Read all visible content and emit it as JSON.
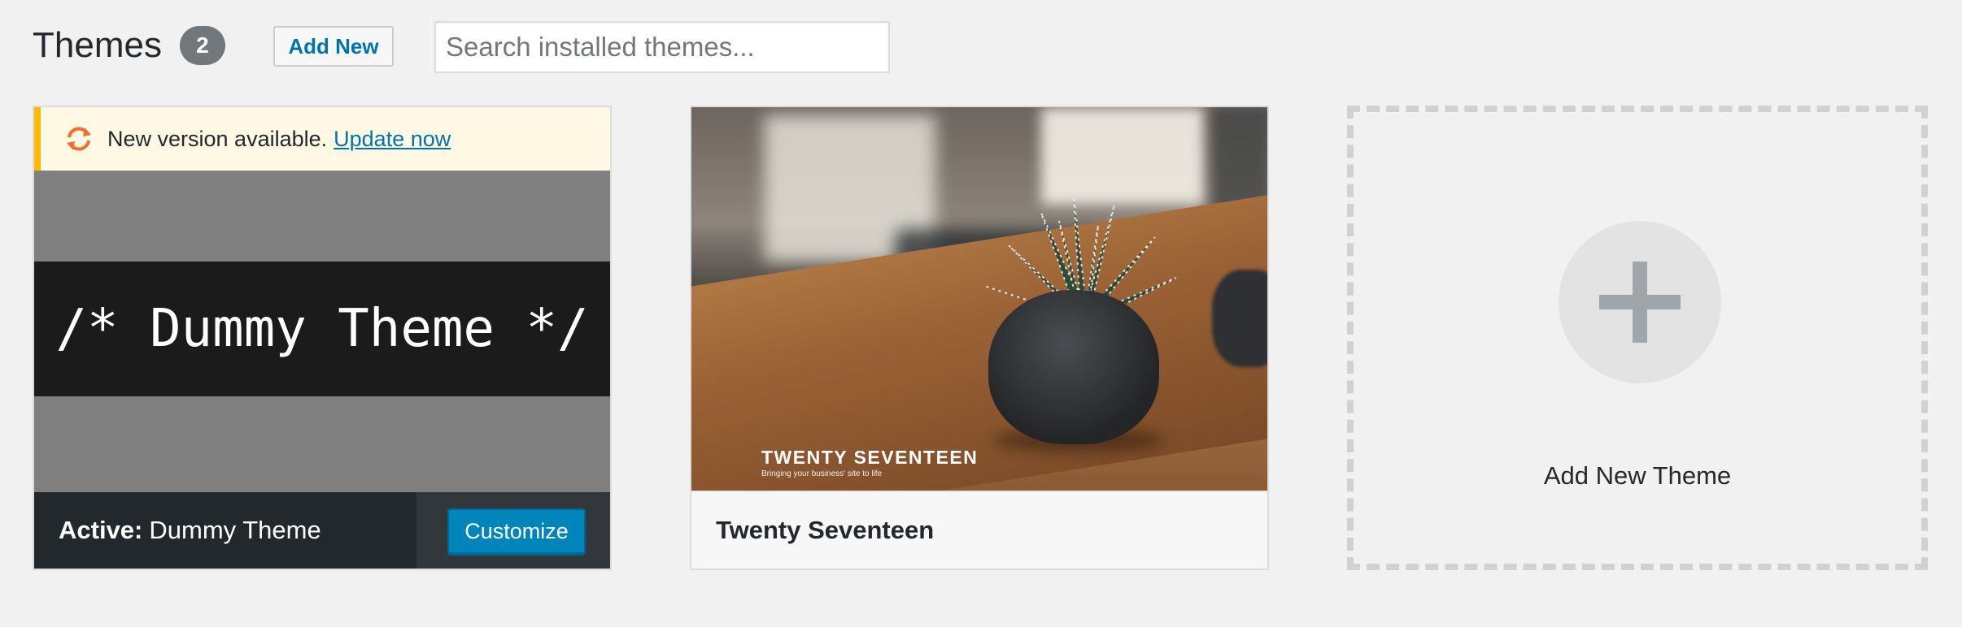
{
  "header": {
    "title": "Themes",
    "count": "2",
    "add_new_label": "Add New",
    "search_placeholder": "Search installed themes..."
  },
  "active_theme": {
    "notice_text": "New version available.",
    "notice_link": "Update now",
    "screenshot_text": "/* Dummy Theme */",
    "active_prefix": "Active:",
    "name": "Dummy Theme",
    "customize_label": "Customize"
  },
  "themes": [
    {
      "name": "Twenty Seventeen",
      "screenshot_title": "TWENTY SEVENTEEN",
      "screenshot_tagline": "Bringing your business' site to life"
    }
  ],
  "add_new_theme": {
    "label": "Add New Theme"
  },
  "colors": {
    "background": "#f1f1f1",
    "link": "#0073aa",
    "primary_button": "#0085ba",
    "notice_border": "#ffb900",
    "update_icon": "#f56e28"
  },
  "icons": {
    "update": "update-arrows-icon",
    "add": "plus-icon"
  }
}
